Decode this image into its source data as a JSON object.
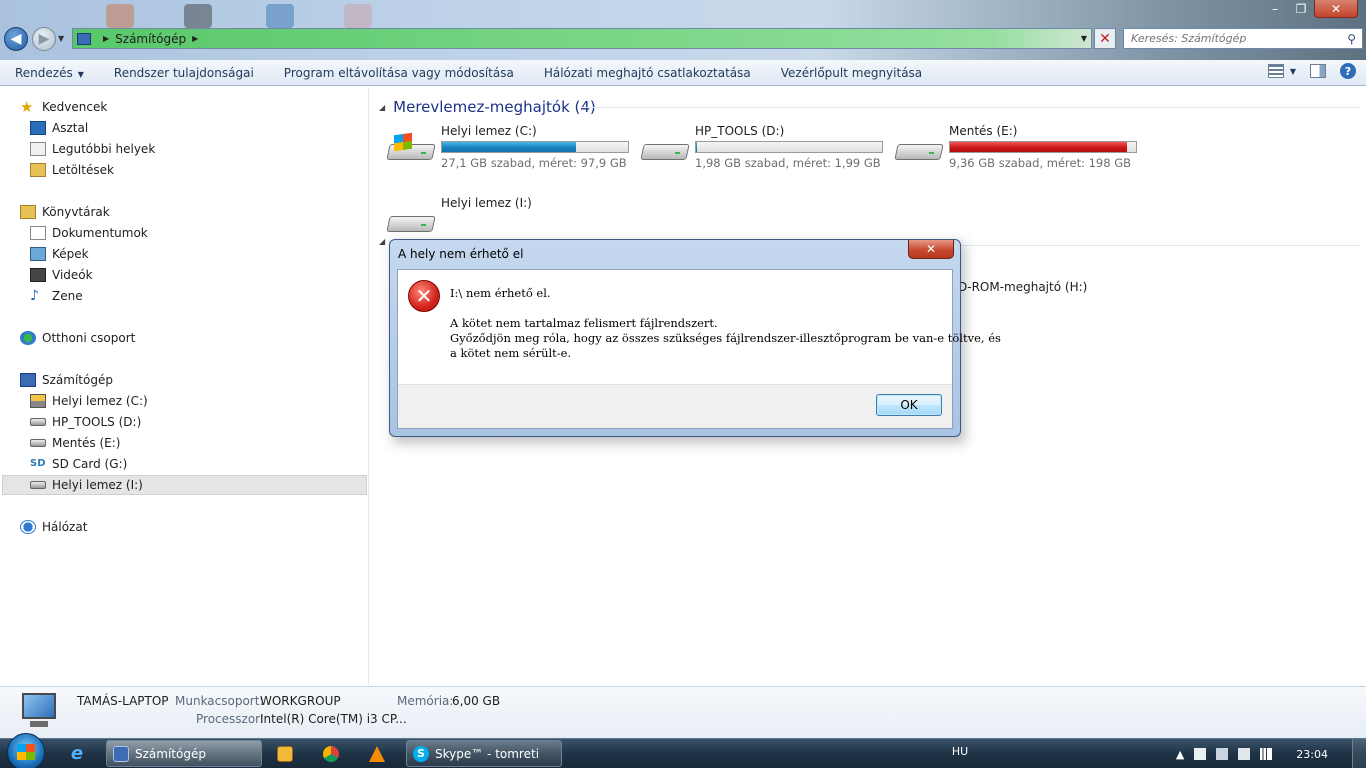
{
  "window": {
    "minimize_glyph": "–",
    "maximize_glyph": "❐",
    "close_glyph": "✕"
  },
  "address_bar": {
    "crumb": "Számítógép",
    "search_placeholder": "Keresés: Számítógép"
  },
  "command_bar": {
    "items": [
      {
        "label": "Rendezés",
        "dropdown": true
      },
      {
        "label": "Rendszer tulajdonságai"
      },
      {
        "label": "Program eltávolítása vagy módosítása"
      },
      {
        "label": "Hálózati meghajtó csatlakoztatása"
      },
      {
        "label": "Vezérlőpult megnyitása"
      }
    ]
  },
  "nav": {
    "favorites": "Kedvencek",
    "desktop": "Asztal",
    "recent": "Legutóbbi helyek",
    "downloads": "Letöltések",
    "libraries": "Könyvtárak",
    "documents": "Dokumentumok",
    "pictures": "Képek",
    "videos": "Videók",
    "music": "Zene",
    "homegroup": "Otthoni csoport",
    "computer": "Számítógép",
    "drive_c": "Helyi lemez (C:)",
    "drive_d": "HP_TOOLS (D:)",
    "drive_e": "Mentés (E:)",
    "drive_g": "SD Card (G:)",
    "drive_i": "Helyi lemez (I:)",
    "network": "Hálózat"
  },
  "content": {
    "hdd_group": "Merevlemez-meghajtók (4)",
    "drives": [
      {
        "name": "Helyi lemez (C:)",
        "space": "27,1 GB szabad, méret: 97,9 GB",
        "used_fraction": 0.72,
        "bar_color": "blue",
        "icon": "windows-drive-icon"
      },
      {
        "name": "HP_TOOLS (D:)",
        "space": "1,98 GB szabad, méret: 1,99 GB",
        "used_fraction": 0.005,
        "bar_color": "blue",
        "icon": "drive-icon"
      },
      {
        "name": "Mentés (E:)",
        "space": "9,36 GB szabad, méret: 198 GB",
        "used_fraction": 0.95,
        "bar_color": "red",
        "icon": "drive-icon"
      },
      {
        "name": "Helyi lemez (I:)",
        "icon": "drive-icon"
      }
    ],
    "removable_partial": "D-ROM-meghajtó (H:)"
  },
  "details": {
    "computer_name": "TAMÁS-LAPTOP",
    "workgroup_label": "Munkacsoport:",
    "workgroup_value": "WORKGROUP",
    "memory_label": "Memória:",
    "memory_value": "6,00 GB",
    "processor_label": "Processzor:",
    "processor_value": "Intel(R) Core(TM) i3 CP..."
  },
  "dialog": {
    "title": "A hely nem érhető el",
    "line1": "I:\\ nem érhető el.",
    "line2": "A kötet nem tartalmaz felismert fájlrendszert.",
    "line3": "Győződjön meg róla, hogy az összes szükséges fájlrendszer-illesztőprogram be van-e töltve, és",
    "line4": "a kötet nem sérült-e.",
    "ok": "OK",
    "close_glyph": "✕",
    "error_glyph": "✕"
  },
  "taskbar": {
    "explorer": "Számítógép",
    "skype": "Skype™ - tomreti",
    "language": "HU",
    "clock": "23:04"
  },
  "colors": {
    "bar_blue": "#1a85c5",
    "bar_red": "#d01c1c",
    "group_title": "#1e3287"
  }
}
